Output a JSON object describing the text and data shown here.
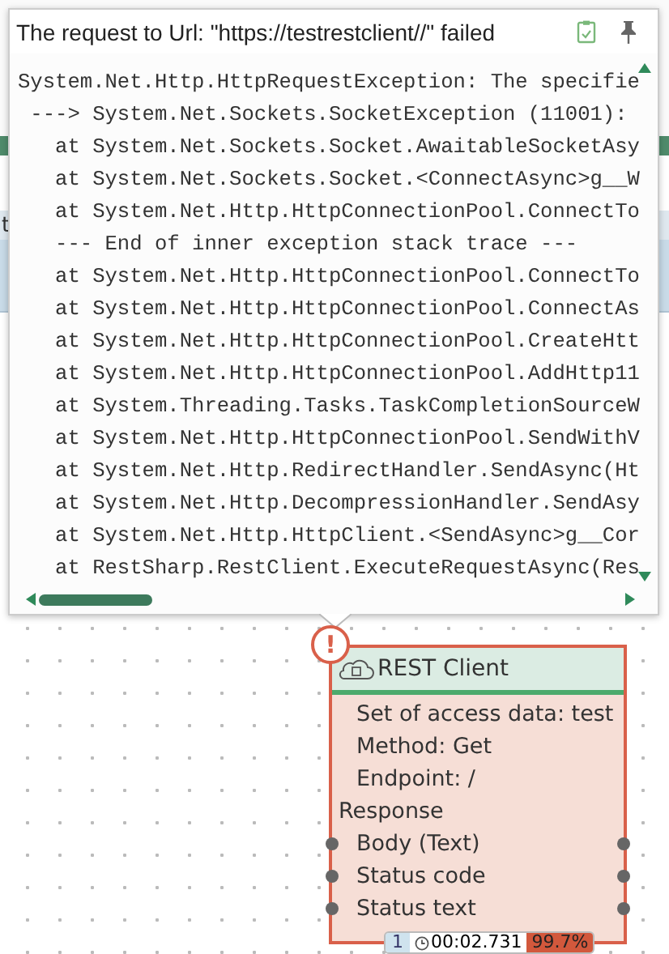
{
  "background": {
    "cell_fragment": "t"
  },
  "popup": {
    "title": "The request to Url: \"https://testrestclient//\" failed",
    "lines": [
      "System.Net.Http.HttpRequestException: The specifie",
      " ---> System.Net.Sockets.SocketException (11001): ",
      "   at System.Net.Sockets.Socket.AwaitableSocketAsy",
      "   at System.Net.Sockets.Socket.<ConnectAsync>g__W",
      "   at System.Net.Http.HttpConnectionPool.ConnectTo",
      "   --- End of inner exception stack trace ---",
      "   at System.Net.Http.HttpConnectionPool.ConnectTo",
      "   at System.Net.Http.HttpConnectionPool.ConnectAs",
      "   at System.Net.Http.HttpConnectionPool.CreateHtt",
      "   at System.Net.Http.HttpConnectionPool.AddHttp11",
      "   at System.Threading.Tasks.TaskCompletionSourceW",
      "   at System.Net.Http.HttpConnectionPool.SendWithV",
      "   at System.Net.Http.RedirectHandler.SendAsync(Ht",
      "   at System.Net.Http.DecompressionHandler.SendAsy",
      "   at System.Net.Http.HttpClient.<SendAsync>g__Cor",
      "   at RestSharp.RestClient.ExecuteRequestAsync(Res"
    ]
  },
  "node": {
    "error_badge": "!",
    "title": "REST Client",
    "rows": [
      {
        "kind": "setting",
        "label": "Set of access data: test"
      },
      {
        "kind": "setting",
        "label": "Method: Get"
      },
      {
        "kind": "setting",
        "label": "Endpoint: /"
      },
      {
        "kind": "section",
        "label": "Response"
      },
      {
        "kind": "output",
        "label": "Body (Text)"
      },
      {
        "kind": "output",
        "label": "Status code"
      },
      {
        "kind": "output",
        "label": "Status text"
      }
    ],
    "footer": {
      "count": "1",
      "time": "00:02.731",
      "percent": "99.7%"
    }
  }
}
